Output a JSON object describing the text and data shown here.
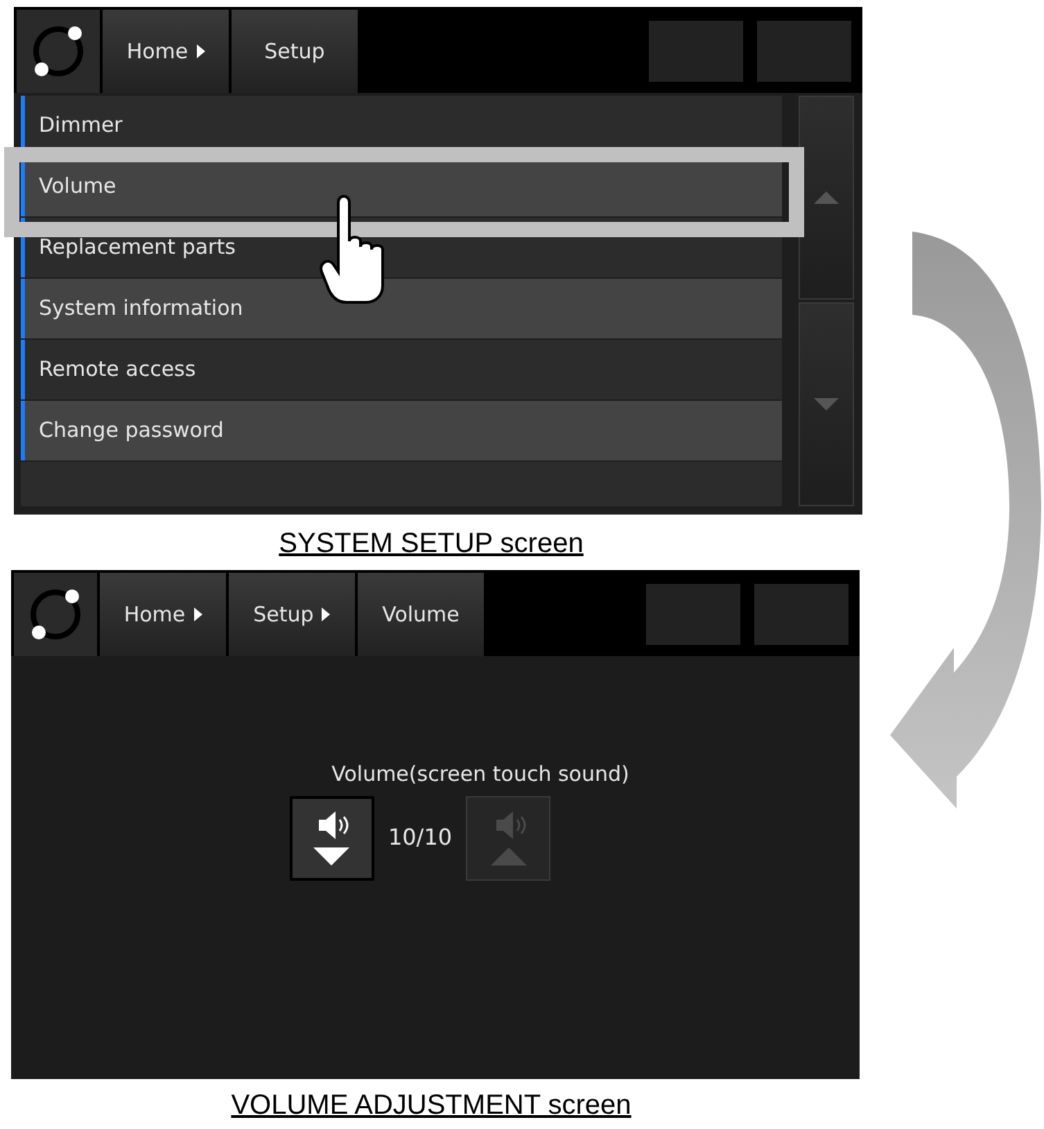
{
  "setup_screen": {
    "breadcrumbs": [
      {
        "label": "Home",
        "arrow": true
      },
      {
        "label": "Setup",
        "arrow": false
      }
    ],
    "menu_items": [
      {
        "label": "Dimmer",
        "selected": false
      },
      {
        "label": "Volume",
        "selected": true
      },
      {
        "label": "Replacement parts",
        "selected": false
      },
      {
        "label": "System information",
        "selected": false
      },
      {
        "label": "Remote access",
        "selected": false
      },
      {
        "label": "Change password",
        "selected": false
      }
    ],
    "caption": "SYSTEM SETUP screen"
  },
  "volume_screen": {
    "breadcrumbs": [
      {
        "label": "Home",
        "arrow": true
      },
      {
        "label": "Setup",
        "arrow": true
      },
      {
        "label": "Volume",
        "arrow": false
      }
    ],
    "label": "Volume(screen touch sound)",
    "reading": "10/10",
    "buttons": [
      {
        "kind": "down",
        "disabled": false
      },
      {
        "kind": "up",
        "disabled": true
      }
    ],
    "caption": "VOLUME ADJUSTMENT screen"
  }
}
